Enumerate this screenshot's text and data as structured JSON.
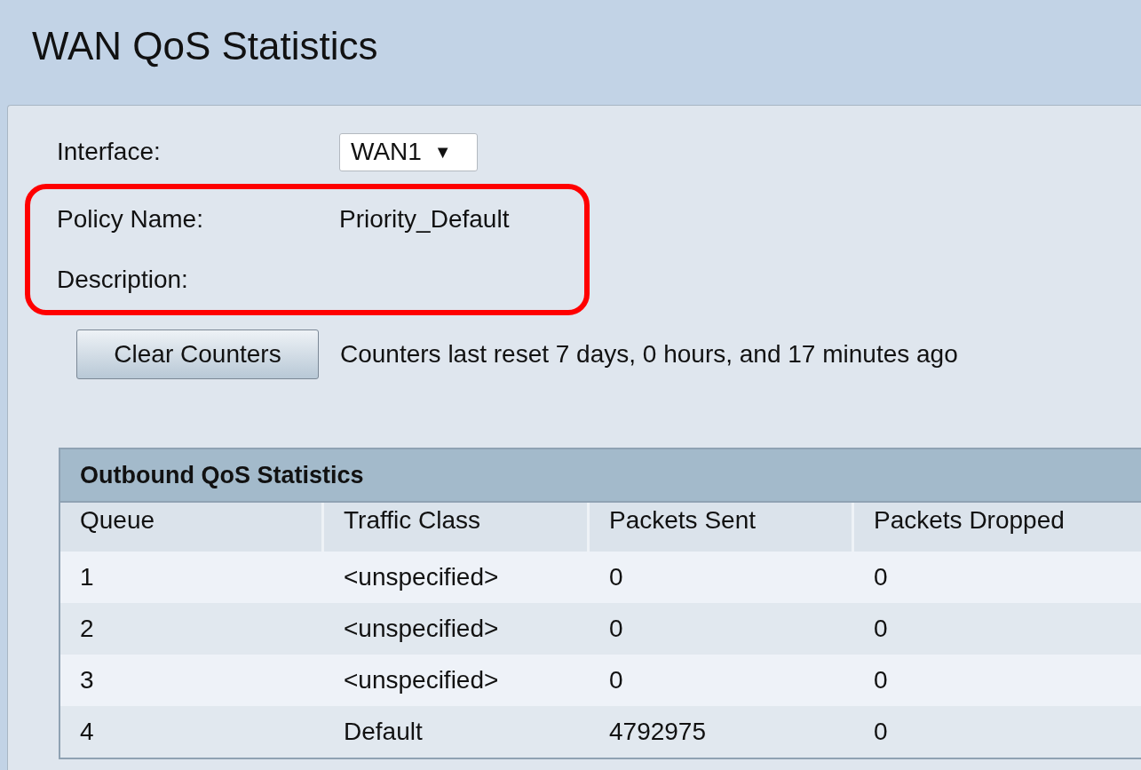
{
  "page": {
    "title": "WAN QoS Statistics"
  },
  "fields": [
    {
      "label": "Interface:",
      "kind": "select",
      "value": "WAN1",
      "caret": "▼",
      "highlighted": false
    },
    {
      "label": "Policy Name:",
      "kind": "text",
      "value": "Priority_Default",
      "highlighted": true
    },
    {
      "label": "Description:",
      "kind": "text",
      "highlighted": true
    }
  ],
  "counters": {
    "button": "Clear Counters",
    "status": "Counters last reset 7 days, 0 hours, and 17 minutes ago"
  },
  "table": {
    "title": "Outbound QoS Statistics",
    "columns": [
      "Queue",
      "Traffic Class",
      "Packets Sent",
      "Packets Dropped"
    ],
    "rows": [
      [
        "1",
        "<unspecified>",
        "0",
        "0"
      ],
      [
        "2",
        "<unspecified>",
        "0",
        "0"
      ],
      [
        "3",
        "<unspecified>",
        "0",
        "0"
      ],
      [
        "4",
        "Default",
        "4792975",
        "0"
      ]
    ]
  }
}
